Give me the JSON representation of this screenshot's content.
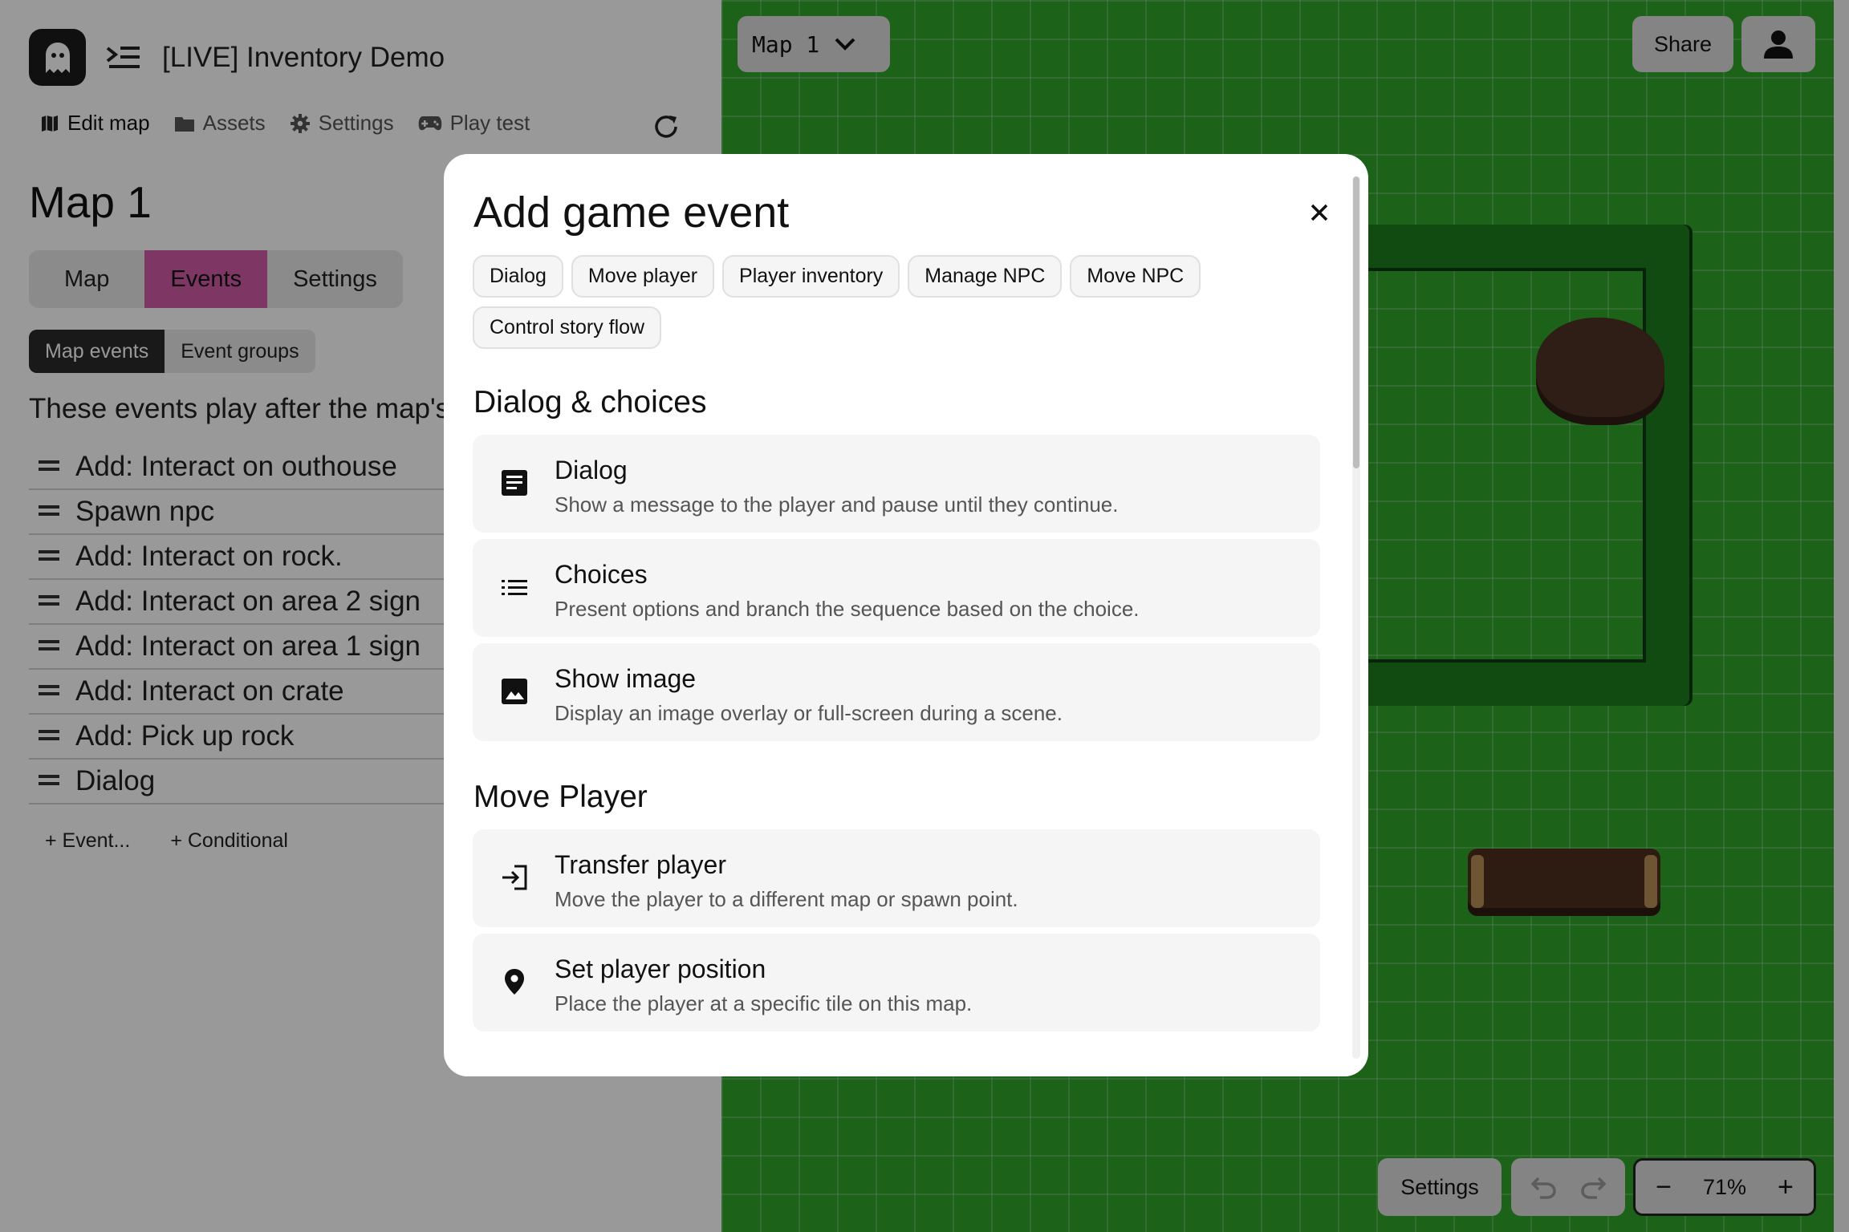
{
  "app": {
    "title": "[LIVE] Inventory Demo",
    "nav": [
      {
        "label": "Edit map",
        "icon": "map-icon"
      },
      {
        "label": "Assets",
        "icon": "folder-icon"
      },
      {
        "label": "Settings",
        "icon": "gear-icon"
      },
      {
        "label": "Play test",
        "icon": "gamepad-icon"
      }
    ]
  },
  "editor": {
    "map_title": "Map 1",
    "tabs": [
      "Map",
      "Events",
      "Settings"
    ],
    "active_tab": "Events",
    "subtabs": [
      "Map events",
      "Event groups"
    ],
    "active_subtab": "Map events",
    "intro": "These events play after the map's",
    "events": [
      "Add: Interact on outhouse",
      "Spawn npc",
      "Add: Interact on rock.",
      "Add: Interact on area 2 sign",
      "Add: Interact on area 1 sign",
      "Add: Interact on crate",
      "Add: Pick up rock",
      "Dialog"
    ],
    "add_event": "+ Event...",
    "add_conditional": "+ Conditional"
  },
  "map_view": {
    "map_select": "Map 1",
    "share": "Share",
    "settings": "Settings",
    "zoom": "71%",
    "zoom_minus": "−",
    "zoom_plus": "+"
  },
  "modal": {
    "title": "Add game event",
    "chips": [
      "Dialog",
      "Move player",
      "Player inventory",
      "Manage NPC",
      "Move NPC",
      "Control story flow"
    ],
    "sections": [
      {
        "title": "Dialog & choices",
        "items": [
          {
            "title": "Dialog",
            "desc": "Show a message to the player and pause until they continue.",
            "icon": "dialog-icon"
          },
          {
            "title": "Choices",
            "desc": "Present options and branch the sequence based on the choice.",
            "icon": "list-icon"
          },
          {
            "title": "Show image",
            "desc": "Display an image overlay or full-screen during a scene.",
            "icon": "image-icon"
          }
        ]
      },
      {
        "title": "Move Player",
        "items": [
          {
            "title": "Transfer player",
            "desc": "Move the player to a different map or spawn point.",
            "icon": "login-arrow-icon"
          },
          {
            "title": "Set player position",
            "desc": "Place the player at a specific tile on this map.",
            "icon": "location-pin-icon"
          }
        ]
      }
    ]
  },
  "colors": {
    "events_tab": "#d25da8",
    "grass": "#2fa52a",
    "hedge": "#1f7e1f"
  }
}
